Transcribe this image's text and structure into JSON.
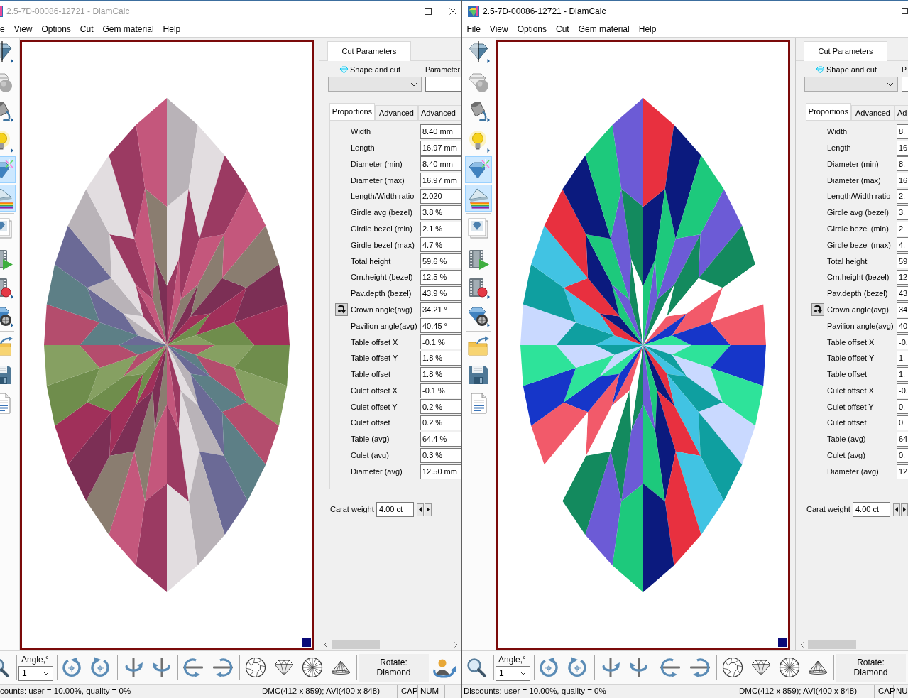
{
  "windows": [
    {
      "active": false,
      "title": "2.5-7D-00086-12721 - DiamCalc",
      "menu": [
        "e",
        "View",
        "Options",
        "Cut",
        "Gem material",
        "Help"
      ],
      "toolbar": [
        {
          "selected": false
        },
        {
          "selected": false
        },
        {
          "selected": false
        },
        {
          "selected": false
        },
        {
          "selected": true
        },
        {
          "selected": true
        },
        {
          "selected": false
        },
        {
          "selected": false
        },
        {
          "selected": false
        },
        {
          "selected": false
        },
        {
          "selected": false
        },
        {
          "selected": false
        },
        {
          "selected": false
        }
      ],
      "gem_render": {
        "kind": "muted"
      },
      "panel": {
        "tab": {
          "label": "Cut Parameters",
          "selected": true
        },
        "shape_label": "Shape and cut",
        "parameters_label": "Parameter",
        "subtabs": [
          {
            "label": "Proportions",
            "selected": true
          },
          {
            "label": "Advanced",
            "selected": false
          },
          {
            "label": "Advanced",
            "selected": false
          }
        ],
        "rows": [
          {
            "label": "Width",
            "value": "8.40 mm",
            "kind": "plain"
          },
          {
            "label": "Length",
            "value": "16.97 mm",
            "kind": "plain"
          },
          {
            "label": "Diameter (min)",
            "value": "8.40 mm",
            "kind": "plain"
          },
          {
            "label": "Diameter (max)",
            "value": "16.97 mm",
            "kind": "plain"
          },
          {
            "label": "Length/Width ratio",
            "value": "2.020",
            "kind": "plain"
          },
          {
            "label": "Girdle avg (bezel)",
            "value": "3.8 %",
            "kind": "plain"
          },
          {
            "label": "Girdle bezel (min)",
            "value": "2.1 %",
            "kind": "plain"
          },
          {
            "label": "Girdle bezel (max)",
            "value": "4.7 %",
            "kind": "plain"
          },
          {
            "label": "Total height",
            "value": "59.6 %",
            "kind": "plain"
          },
          {
            "label": "Crn.height (bezel)",
            "value": "12.5 %",
            "kind": "plain"
          },
          {
            "label": "Pav.depth (bezel)",
            "value": "43.9 %",
            "kind": "plain"
          },
          {
            "label": "Crown angle(avg)",
            "value": "34.21 °",
            "kind": "toggle"
          },
          {
            "label": "Pavilion angle(avg)",
            "value": "40.45 °",
            "kind": "plain"
          },
          {
            "label": "Table offset X",
            "value": "-0.1 %",
            "kind": "plain"
          },
          {
            "label": "Table offset Y",
            "value": "1.8 %",
            "kind": "plain"
          },
          {
            "label": "Table offset",
            "value": "1.8 %",
            "kind": "plain"
          },
          {
            "label": "Culet offset X",
            "value": "-0.1 %",
            "kind": "plain"
          },
          {
            "label": "Culet offset Y",
            "value": "0.2 %",
            "kind": "plain"
          },
          {
            "label": "Culet offset",
            "value": "0.2 %",
            "kind": "plain"
          },
          {
            "label": "Table (avg)",
            "value": "64.4 %",
            "kind": "plain"
          },
          {
            "label": "Culet (avg)",
            "value": "0.3 %",
            "kind": "plain"
          },
          {
            "label": "Diameter (avg)",
            "value": "12.50 mm",
            "kind": "plain"
          }
        ],
        "carat_weight": {
          "label": "Carat weight",
          "value": "4.00 ct"
        }
      },
      "bottom_toolbar": {
        "angle_label": "Angle,°",
        "angle_value": "1",
        "rotate_button": "Rotate: Diamond"
      },
      "status_bar": [
        "counts: user = 10.00%, quality = 0%",
        "DMC(412 x 859); AVI(400 x 848)",
        "CAP",
        "NUM"
      ]
    },
    {
      "active": true,
      "title": "2.5-7D-00086-12721 - DiamCalc",
      "menu": [
        "File",
        "View",
        "Options",
        "Cut",
        "Gem material",
        "Help"
      ],
      "toolbar": [
        {
          "selected": false
        },
        {
          "selected": false
        },
        {
          "selected": false
        },
        {
          "selected": false
        },
        {
          "selected": true
        },
        {
          "selected": true
        },
        {
          "selected": false
        },
        {
          "selected": false
        },
        {
          "selected": false
        },
        {
          "selected": false
        },
        {
          "selected": false
        },
        {
          "selected": false
        },
        {
          "selected": false
        }
      ],
      "gem_render": {
        "kind": "vivid"
      },
      "panel": {
        "tab": {
          "label": "Cut Parameters",
          "selected": true
        },
        "shape_label": "Shape and cut",
        "parameters_label": "P",
        "subtabs": [
          {
            "label": "Proportions",
            "selected": true
          },
          {
            "label": "Advanced",
            "selected": false
          },
          {
            "label": "Ad",
            "selected": false
          }
        ],
        "rows": [
          {
            "label": "Width",
            "value": "8.",
            "kind": "plain"
          },
          {
            "label": "Length",
            "value": "16",
            "kind": "plain"
          },
          {
            "label": "Diameter (min)",
            "value": "8.",
            "kind": "plain"
          },
          {
            "label": "Diameter (max)",
            "value": "16",
            "kind": "plain"
          },
          {
            "label": "Length/Width ratio",
            "value": "2.",
            "kind": "plain"
          },
          {
            "label": "Girdle avg (bezel)",
            "value": "3.",
            "kind": "plain"
          },
          {
            "label": "Girdle bezel (min)",
            "value": "2.",
            "kind": "plain"
          },
          {
            "label": "Girdle bezel (max)",
            "value": "4.",
            "kind": "plain"
          },
          {
            "label": "Total height",
            "value": "59",
            "kind": "plain"
          },
          {
            "label": "Crn.height (bezel)",
            "value": "12",
            "kind": "plain"
          },
          {
            "label": "Pav.depth (bezel)",
            "value": "43",
            "kind": "plain"
          },
          {
            "label": "Crown angle(avg)",
            "value": "34",
            "kind": "toggle"
          },
          {
            "label": "Pavilion angle(avg)",
            "value": "40",
            "kind": "plain"
          },
          {
            "label": "Table offset X",
            "value": "-0.",
            "kind": "plain"
          },
          {
            "label": "Table offset Y",
            "value": "1.",
            "kind": "plain"
          },
          {
            "label": "Table offset",
            "value": "1.",
            "kind": "plain"
          },
          {
            "label": "Culet offset X",
            "value": "-0.",
            "kind": "plain"
          },
          {
            "label": "Culet offset Y",
            "value": "0.",
            "kind": "plain"
          },
          {
            "label": "Culet offset",
            "value": "0.",
            "kind": "plain"
          },
          {
            "label": "Table (avg)",
            "value": "64",
            "kind": "plain"
          },
          {
            "label": "Culet (avg)",
            "value": "0.",
            "kind": "plain"
          },
          {
            "label": "Diameter (avg)",
            "value": "12",
            "kind": "plain"
          }
        ],
        "carat_weight": {
          "label": "Carat weight",
          "value": "4.00 ct"
        }
      },
      "bottom_toolbar": {
        "angle_label": "Angle,°",
        "angle_value": "1",
        "rotate_button": "Rotate: Diamond"
      },
      "status_bar": [
        "Discounts: user = 10.00%, quality = 0%",
        "DMC(412 x 859); AVI(400 x 848)",
        "CAP",
        "NU"
      ]
    }
  ]
}
